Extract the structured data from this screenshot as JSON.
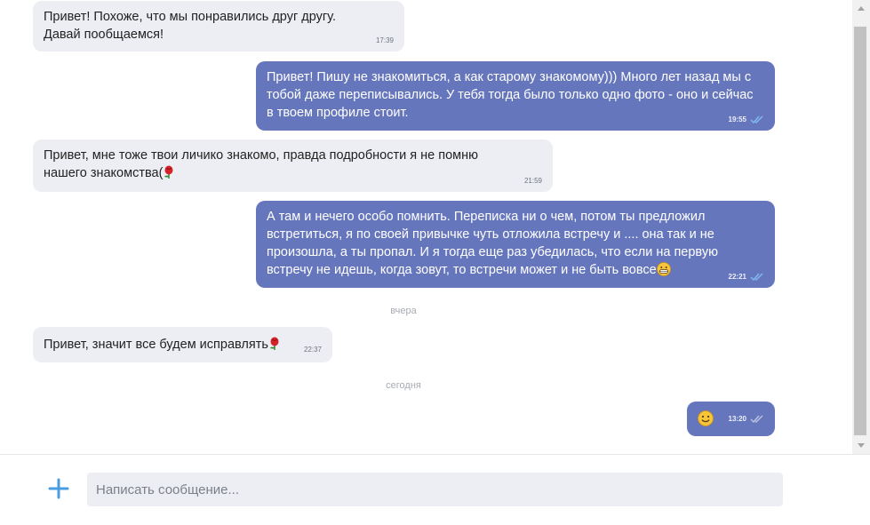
{
  "messages": [
    {
      "text": "Привет! Похоже, что мы понравились друг другу. Давай пообщаемся!",
      "time": "17:39"
    },
    {
      "text": "Привет! Пишу не знакомиться, а как старому знакомому))) Много лет назад мы с тобой даже переписывались. У тебя тогда было только одно фото - оно и сейчас в твоем профиле стоит.",
      "time": "19:55"
    },
    {
      "text": "Привет, мне тоже твои личико знакомо, правда подробности я не помню нашего знакомства(",
      "time": "21:59"
    },
    {
      "text": "А там и нечего особо помнить. Переписка ни о чем, потом ты предложил встретиться, я по своей привычке чуть отложила встречу и .... она так и не произошла, а ты пропал. И я тогда еще раз убедилась, что если на первую встречу не идешь, когда зовут, то встречи может и не быть вовсе",
      "time": "22:21"
    },
    {
      "text": "Привет, значит все будем исправлять",
      "time": "22:37"
    },
    {
      "text": "",
      "time": "13:20"
    }
  ],
  "date_separators": {
    "yesterday": "вчера",
    "today": "сегодня"
  },
  "composer": {
    "placeholder": "Написать сообщение..."
  },
  "colors": {
    "incoming_bubble": "#eceef4",
    "outgoing_bubble": "#6676bd",
    "accent": "#4a9de0"
  },
  "icons": [
    "rose-emoji",
    "grin-emoji",
    "smile-emoji",
    "read-check-icon",
    "plus-icon"
  ]
}
